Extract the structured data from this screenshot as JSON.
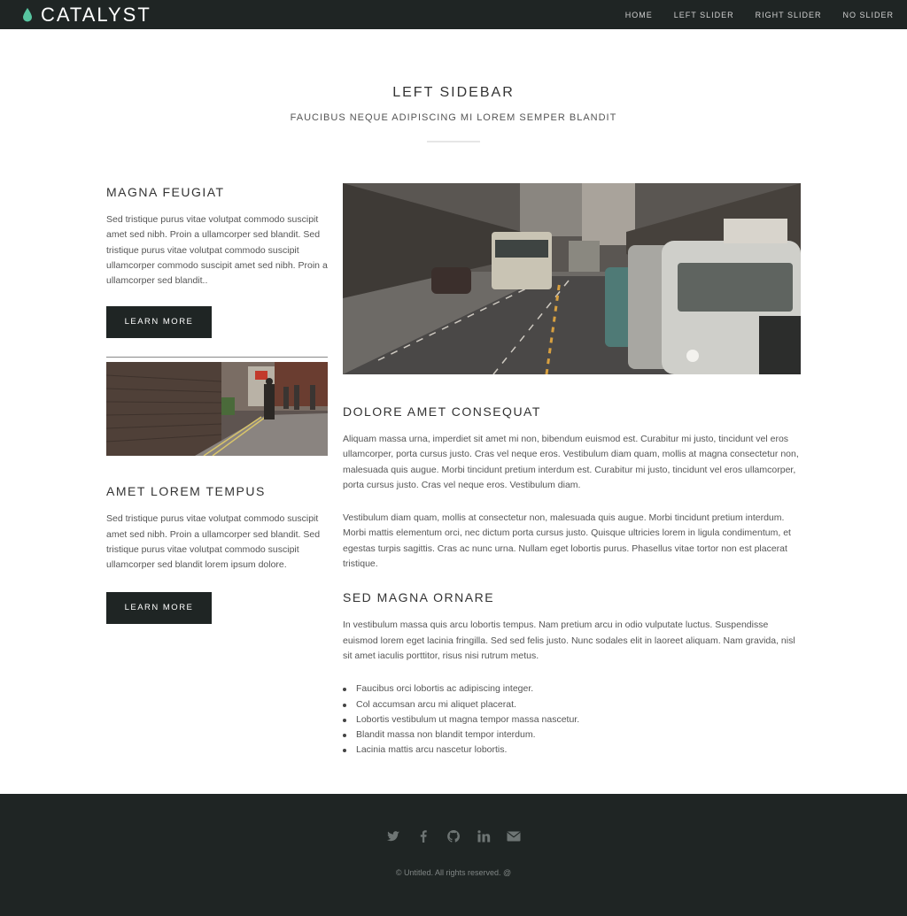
{
  "brand": {
    "name": "CATALYST",
    "accent_color": "#57c5a0"
  },
  "nav": {
    "items": [
      {
        "label": "HOME"
      },
      {
        "label": "LEFT SLIDER"
      },
      {
        "label": "RIGHT SLIDER"
      },
      {
        "label": "NO SLIDER"
      }
    ]
  },
  "page": {
    "title": "LEFT SIDEBAR",
    "subtitle": "FAUCIBUS NEQUE ADIPISCING MI LOREM SEMPER BLANDIT"
  },
  "sidebar": {
    "sections": [
      {
        "heading": "MAGNA FEUGIAT",
        "text": "Sed tristique purus vitae volutpat commodo suscipit amet sed nibh. Proin a ullamcorper sed blandit. Sed tristique purus vitae volutpat commodo suscipit ullamcorper commodo suscipit amet sed nibh. Proin a ullamcorper sed blandit..",
        "button": "LEARN MORE"
      },
      {
        "heading": "AMET LOREM TEMPUS",
        "text": "Sed tristique purus vitae volutpat commodo suscipit amet sed nibh. Proin a ullamcorper sed blandit. Sed tristique purus vitae volutpat commodo suscipit ullamcorper sed blandit lorem ipsum dolore.",
        "button": "LEARN MORE"
      }
    ]
  },
  "main": {
    "section1": {
      "heading": "DOLORE AMET CONSEQUAT",
      "p1": "Aliquam massa urna, imperdiet sit amet mi non, bibendum euismod est. Curabitur mi justo, tincidunt vel eros ullamcorper, porta cursus justo. Cras vel neque eros. Vestibulum diam quam, mollis at magna consectetur non, malesuada quis augue. Morbi tincidunt pretium interdum est. Curabitur mi justo, tincidunt vel eros ullamcorper, porta cursus justo. Cras vel neque eros. Vestibulum diam.",
      "p2": "Vestibulum diam quam, mollis at consectetur non, malesuada quis augue. Morbi tincidunt pretium interdum. Morbi mattis elementum orci, nec dictum porta cursus justo. Quisque ultricies lorem in ligula condimentum, et egestas turpis sagittis. Cras ac nunc urna. Nullam eget lobortis purus. Phasellus vitae tortor non est placerat tristique."
    },
    "section2": {
      "heading": "SED MAGNA ORNARE",
      "p1": "In vestibulum massa quis arcu lobortis tempus. Nam pretium arcu in odio vulputate luctus. Suspendisse euismod lorem eget lacinia fringilla. Sed sed felis justo. Nunc sodales elit in laoreet aliquam. Nam gravida, nisl sit amet iaculis porttitor, risus nisi rutrum metus.",
      "list": [
        "Faucibus orci lobortis ac adipiscing integer.",
        "Col accumsan arcu mi aliquet placerat.",
        "Lobortis vestibulum ut magna tempor massa nascetur.",
        "Blandit massa non blandit tempor interdum.",
        "Lacinia mattis arcu nascetur lobortis."
      ]
    }
  },
  "footer": {
    "icons": [
      "twitter-icon",
      "facebook-icon",
      "github-icon",
      "linkedin-icon",
      "envelope-icon"
    ],
    "copyright": "© Untitled. All rights reserved. @"
  }
}
